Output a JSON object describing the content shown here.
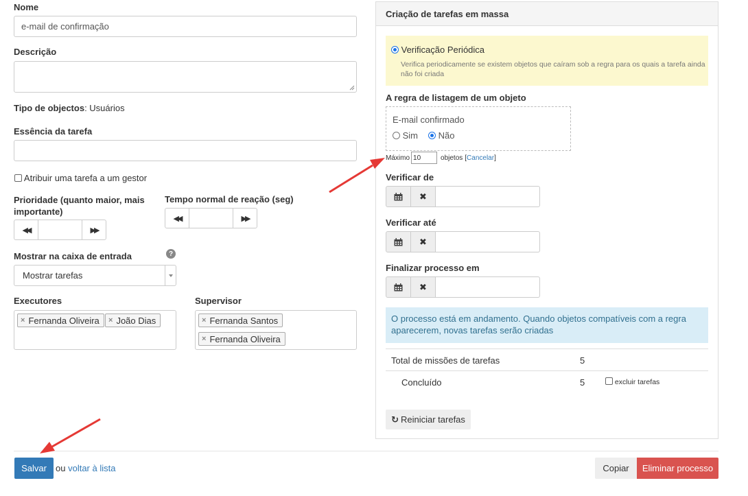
{
  "form": {
    "name_label": "Nome",
    "name_value": "e-mail de confirmação",
    "description_label": "Descrição",
    "object_type_label": "Tipo de objectos",
    "object_type_value": ": Usuários",
    "essence_label": "Essência da tarefa",
    "assign_manager_label": "Atribuir uma tarefa a um gestor",
    "priority_label_1": "Prioridade (quanto maior, mais",
    "priority_label_2": "importante)",
    "reaction_label": "Tempo normal de reação (seg)",
    "inbox_label": "Mostrar na caixa de entrada",
    "inbox_value": "Mostrar tarefas",
    "executors_label": "Executores",
    "executors": [
      "Fernanda Oliveira",
      "João Dias"
    ],
    "supervisor_label": "Supervisor",
    "supervisors": [
      "Fernanda Santos",
      "Fernanda Oliveira"
    ]
  },
  "bulk": {
    "title": "Criação de tarefas em massa",
    "periodic_label": "Verificação Periódica",
    "periodic_desc_1": "Verifica periodicamente se existem objetos que caíram sob a regra para os quais a tarefa ainda",
    "periodic_desc_2": "não foi criada",
    "rule_label": "A regra de listagem de um objeto",
    "rule_field": "E-mail confirmado",
    "yes": "Sim",
    "no": "Não",
    "max_label": "Máximo",
    "max_value": "10",
    "objects_label": "objetos",
    "bracket_open": "[",
    "cancel": "Cancelar",
    "bracket_close": "]",
    "check_from_label": "Verificar de",
    "check_until_label": "Verificar até",
    "finish_label": "Finalizar processo em",
    "info_1": "O processo está em andamento. Quando objetos compatíveis com a regra",
    "info_2": "aparecerem, novas tarefas serão criadas",
    "total_label": "Total de missões de tarefas",
    "total_value": "5",
    "done_label": "Concluído",
    "done_value": "5",
    "exclude_label": "excluir tarefas",
    "restart_label": "Reiniciar tarefas"
  },
  "footer": {
    "save": "Salvar",
    "or": "ou",
    "back": "voltar à lista",
    "copy": "Copiar",
    "delete": "Eliminar processo"
  },
  "colors": {
    "primary": "#337ab7",
    "danger": "#d9534f",
    "annotation_arrow": "#e53935",
    "warning_bg": "#fcf8cf",
    "info_bg": "#d9edf7"
  }
}
